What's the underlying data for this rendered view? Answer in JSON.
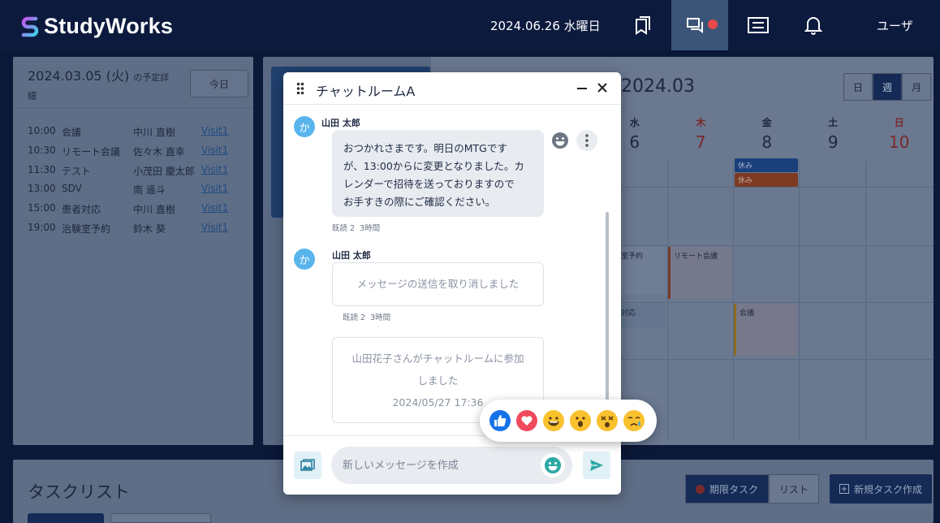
{
  "app": {
    "name": "StudyWorks",
    "date": "2024.06.26 水曜日",
    "user": "ユーザ"
  },
  "topbar": {
    "icons": [
      "bookmarks-icon",
      "chat-icon",
      "list-icon",
      "bell-icon"
    ],
    "notify_color": "#e74a4a"
  },
  "left_panel": {
    "title": "2024.03.05 (火)",
    "title_suffix": "の予定詳",
    "title_suffix2": "細",
    "today_label": "今日",
    "schedule": [
      {
        "time": "10:00",
        "name": "会議",
        "person": "中川 直樹",
        "link": "Visit1"
      },
      {
        "time": "10:30",
        "name": "リモート会議",
        "person": "佐々木 直幸",
        "link": "Visit1"
      },
      {
        "time": "11:30",
        "name": "テスト",
        "person": "小茂田 慶太郎",
        "link": "Visit1"
      },
      {
        "time": "13:00",
        "name": "SDV",
        "person": "南 遥斗",
        "link": "Visit1"
      },
      {
        "time": "15:00",
        "name": "患者対応",
        "person": "中川 直樹",
        "link": "Visit1"
      },
      {
        "time": "19:00",
        "name": "治験室予約",
        "person": "鈴木 葵",
        "link": "Visit1"
      }
    ]
  },
  "calendar": {
    "month": "2024.03",
    "views": [
      "日",
      "週",
      "月"
    ],
    "active_view": "週",
    "days": [
      {
        "name": "水",
        "date": "6"
      },
      {
        "name": "木",
        "date": "7"
      },
      {
        "name": "金",
        "date": "8"
      },
      {
        "name": "土",
        "date": "9"
      },
      {
        "name": "日",
        "date": "10"
      }
    ],
    "events": {
      "off1": "休み",
      "off2": "休み",
      "rsv": "室予約",
      "remote": "リモート会議",
      "resp": "対応",
      "meeting": "会議"
    }
  },
  "tasks": {
    "title": "タスクリスト",
    "deadline_btn": "期限タスク",
    "list_btn": "リスト",
    "new_btn": "新規タスク作成"
  },
  "chat": {
    "title": "チャットルームA",
    "messages": [
      {
        "avatar": "か",
        "sender": "山田 太郎",
        "lines": [
          "おつかれさまです。明日のMTGですが、13:00からに変更となりました。カ",
          "レンダーで招待を送っておりますので",
          "お手すきの際にご確認ください。"
        ],
        "line1a": "おつかれさまです。明日のMTGです",
        "line1b": "が、13:00からに変更となりました。カ",
        "read": "既読 2",
        "time": "3時間"
      },
      {
        "avatar": "か",
        "sender": "山田 太郎",
        "text": "メッセージの送信を取り消しました",
        "read": "既読 2",
        "time": "3時間"
      }
    ],
    "system": {
      "line1": "山田花子さんがチャットルームに参加",
      "line2": "しました",
      "timestamp": "2024/05/27 17:36"
    },
    "input_placeholder": "新しいメッセージを作成",
    "reactions": [
      "thumbs-up",
      "heart",
      "grin",
      "surprised",
      "dizzy",
      "crying"
    ]
  }
}
